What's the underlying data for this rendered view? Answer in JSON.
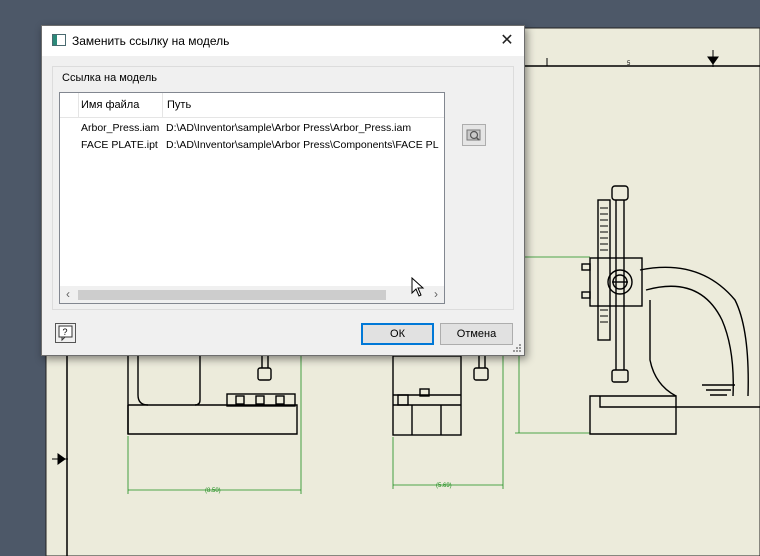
{
  "window": {
    "title": "Заменить ссылку на модель"
  },
  "group": {
    "label": "Ссылка на модель"
  },
  "table": {
    "columns": [
      "Имя файла",
      "Путь"
    ],
    "rows": [
      {
        "name": "Arbor_Press.iam",
        "path": "D:\\AD\\Inventor\\sample\\Arbor Press\\Arbor_Press.iam"
      },
      {
        "name": "FACE PLATE.ipt",
        "path": "D:\\AD\\Inventor\\sample\\Arbor Press\\Components\\FACE PL"
      }
    ]
  },
  "buttons": {
    "ok": "ОК",
    "cancel": "Отмена"
  },
  "drawing": {
    "dimensions": [
      "(8.50)",
      "(5.69)"
    ],
    "ruler_mark": "5"
  },
  "colors": {
    "sheet": "#ecebdb",
    "background": "#4d5868",
    "dimension": "#1a8c1a",
    "accent": "#0078d7"
  }
}
